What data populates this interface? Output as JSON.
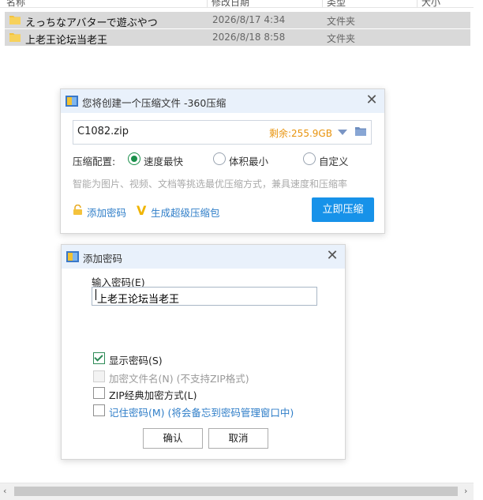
{
  "explorer": {
    "columns": [
      "名称",
      "修改日期",
      "类型",
      "大小"
    ],
    "rows": [
      {
        "name": "えっちなアバターで遊ぶやつ",
        "date": "2026/8/17 4:34",
        "type": "文件夹"
      },
      {
        "name": "上老王论坛当老王",
        "date": "2026/8/18 8:58",
        "type": "文件夹"
      }
    ]
  },
  "compress_dialog": {
    "title": "您将创建一个压缩文件 -360压缩",
    "path": "C1082.zip",
    "free_space": "剩余:255.9GB",
    "config_label": "压缩配置:",
    "options": [
      "速度最快",
      "体积最小",
      "自定义"
    ],
    "selected_option": "速度最快",
    "hint": "智能为图片、视频、文档等挑选最优压缩方式，兼具速度和压缩率",
    "add_password": "添加密码",
    "super_pack": "生成超级压缩包",
    "compress_now": "立即压缩"
  },
  "password_dialog": {
    "title": "添加密码",
    "input_label": "输入密码(E)",
    "password_value": "上老王论坛当老王",
    "checkboxes": [
      {
        "label": "显示密码(S)",
        "checked": true,
        "enabled": true
      },
      {
        "label": "加密文件名(N) (不支持ZIP格式)",
        "checked": false,
        "enabled": false
      },
      {
        "label": "ZIP经典加密方式(L)",
        "checked": false,
        "enabled": true
      },
      {
        "label": "记住密码(M) (将会备忘到密码管理窗口中)",
        "checked": false,
        "enabled": true
      }
    ],
    "ok": "确认",
    "cancel": "取消"
  },
  "colors": {
    "accent": "#1792e9",
    "free_space": "#e8930c",
    "radio_on": "#1a8f4a",
    "link": "#2f7ec8",
    "row_selected": "#d9d9d9",
    "titlebar": "#e9f1fb"
  }
}
